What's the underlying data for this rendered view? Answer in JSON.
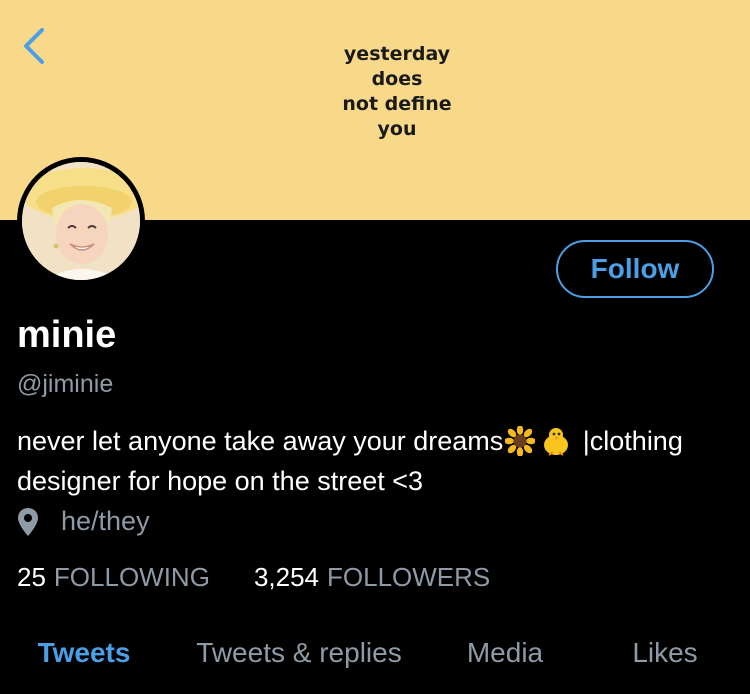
{
  "banner": {
    "lines": [
      "yesterday",
      "does",
      "not define",
      "you"
    ],
    "background": "#f8d98a"
  },
  "profile": {
    "display_name": "minie",
    "handle": "@jiminie",
    "bio_before": "never let anyone take away your dreams",
    "bio_emojis": [
      "sunflower-emoji",
      "chick-emoji"
    ],
    "bio_after": " |clothing designer for hope on the street <3",
    "location": "he/they",
    "follow_label": "Follow"
  },
  "stats": {
    "following_count": "25",
    "following_label": "FOLLOWING",
    "followers_count": "3,254",
    "followers_label": "FOLLOWERS"
  },
  "tabs": [
    {
      "label": "Tweets",
      "active": true
    },
    {
      "label": "Tweets & replies",
      "active": false
    },
    {
      "label": "Media",
      "active": false
    },
    {
      "label": "Likes",
      "active": false
    }
  ],
  "colors": {
    "accent": "#4a9fe6",
    "muted": "#8e9aa5",
    "background": "#000000"
  },
  "icons": [
    "back-chevron-icon",
    "location-pin-icon"
  ]
}
